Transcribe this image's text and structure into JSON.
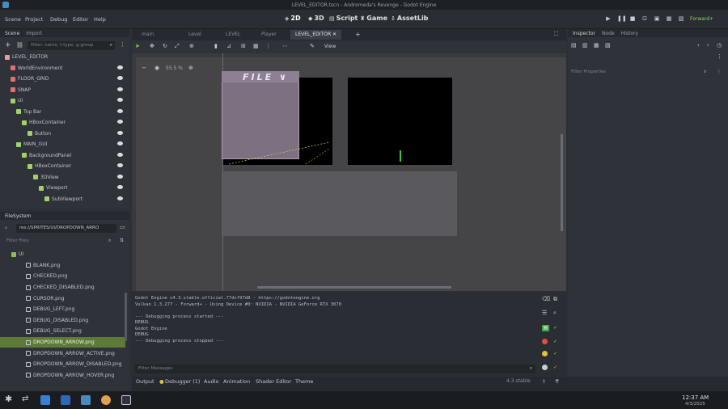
{
  "window": {
    "title": "LEVEL_EDITOR.tscn - Andromeda's Revenge - Godot Engine"
  },
  "menu": [
    "Scene",
    "Project",
    "Debug",
    "Editor",
    "Help"
  ],
  "workspaces": [
    {
      "label": "2D",
      "icon": "2d-icon",
      "active": true
    },
    {
      "label": "3D",
      "icon": "3d-icon",
      "active": false
    },
    {
      "label": "Script",
      "icon": "script-icon",
      "active": false
    },
    {
      "label": "Game",
      "icon": "game-icon",
      "active": false
    },
    {
      "label": "AssetLib",
      "icon": "assetlib-icon",
      "active": false
    }
  ],
  "renderer": "Forward+",
  "scene_panel": {
    "tabs": [
      "Scene",
      "Import"
    ],
    "filter_placeholder": "Filter: name, t:type, g:group",
    "nodes": [
      {
        "label": "LEVEL_EDITOR",
        "icon_color": "#e0a0a0",
        "depth": 0
      },
      {
        "label": "WorldEnvironment",
        "icon_color": "#e07070",
        "depth": 1
      },
      {
        "label": "FLOOR_GRID",
        "icon_color": "#e07070",
        "depth": 1
      },
      {
        "label": "SNAP",
        "icon_color": "#e07070",
        "depth": 1
      },
      {
        "label": "UI",
        "icon_color": "#9fd36a",
        "depth": 1
      },
      {
        "label": "Top Bar",
        "icon_color": "#9fd36a",
        "depth": 2
      },
      {
        "label": "HBoxContainer",
        "icon_color": "#9fd36a",
        "depth": 3
      },
      {
        "label": "Button",
        "icon_color": "#9fd36a",
        "depth": 4
      },
      {
        "label": "MAIN_GUI",
        "icon_color": "#9fd36a",
        "depth": 2
      },
      {
        "label": "BackgroundPanel",
        "icon_color": "#9fd36a",
        "depth": 3
      },
      {
        "label": "HBoxContainer",
        "icon_color": "#9fd36a",
        "depth": 4
      },
      {
        "label": "3DView",
        "icon_color": "#9fd36a",
        "depth": 5
      },
      {
        "label": "Viewport",
        "icon_color": "#9fd36a",
        "depth": 6
      },
      {
        "label": "SubViewport",
        "icon_color": "#9fd36a",
        "depth": 7
      }
    ]
  },
  "filesystem": {
    "title": "FileSystem",
    "path": "res://SPRITES/UI/DROPDOWN_ARRO",
    "filter_placeholder": "Filter Files",
    "files": [
      {
        "label": "UI",
        "folder": true,
        "selected": false
      },
      {
        "label": "BLANK.png",
        "folder": false,
        "selected": false
      },
      {
        "label": "CHECKED.png",
        "folder": false,
        "selected": false
      },
      {
        "label": "CHECKED_DISABLED.png",
        "folder": false,
        "selected": false
      },
      {
        "label": "CURSOR.png",
        "folder": false,
        "selected": false
      },
      {
        "label": "DEBUG_LEFT.png",
        "folder": false,
        "selected": false
      },
      {
        "label": "DEBUG_DISABLED.png",
        "folder": false,
        "selected": false
      },
      {
        "label": "DEBUG_SELECT.png",
        "folder": false,
        "selected": false
      },
      {
        "label": "DROPDOWN_ARROW.png",
        "folder": false,
        "selected": true
      },
      {
        "label": "DROPDOWN_ARROW_ACTIVE.png",
        "folder": false,
        "selected": false
      },
      {
        "label": "DROPDOWN_ARROW_DISABLED.png",
        "folder": false,
        "selected": false
      },
      {
        "label": "DROPDOWN_ARROW_HOVER.png",
        "folder": false,
        "selected": false
      }
    ]
  },
  "editor_tabs": [
    {
      "label": "LEVEL_EDITOR",
      "active": true
    },
    {
      "label": "main",
      "active": false
    },
    {
      "label": "Level",
      "active": false
    },
    {
      "label": "LEVEL",
      "active": false
    },
    {
      "label": "Player",
      "active": false
    }
  ],
  "toolbar": {
    "view_label": "View",
    "zoom": "55.5 %"
  },
  "viewport": {
    "file_menu_label": "FILE ∨"
  },
  "output": {
    "lines": [
      "Godot Engine v4.3.stable.official.77dcf97d8 - https://godotengine.org",
      "Vulkan 1.3.277 - Forward+ - Using Device #0: NVIDIA - NVIDIA GeForce RTX 3070",
      "",
      "--- Debugging process started ---",
      "DEBUG",
      "Godot Engine",
      "DEBUG",
      "--- Debugging process stopped ---"
    ],
    "filter_placeholder": "Filter Messages"
  },
  "bottom_tabs": [
    "Output",
    "Debugger (1)",
    "Audio",
    "Animation",
    "Shader Editor",
    "Theme"
  ],
  "inspector": {
    "tabs": [
      "Inspector",
      "Node",
      "History"
    ],
    "filter_placeholder": "Filter Properties"
  },
  "version": "4.3.stable",
  "taskbar": {
    "time": "12:37 AM",
    "date": "4/3/2025"
  }
}
